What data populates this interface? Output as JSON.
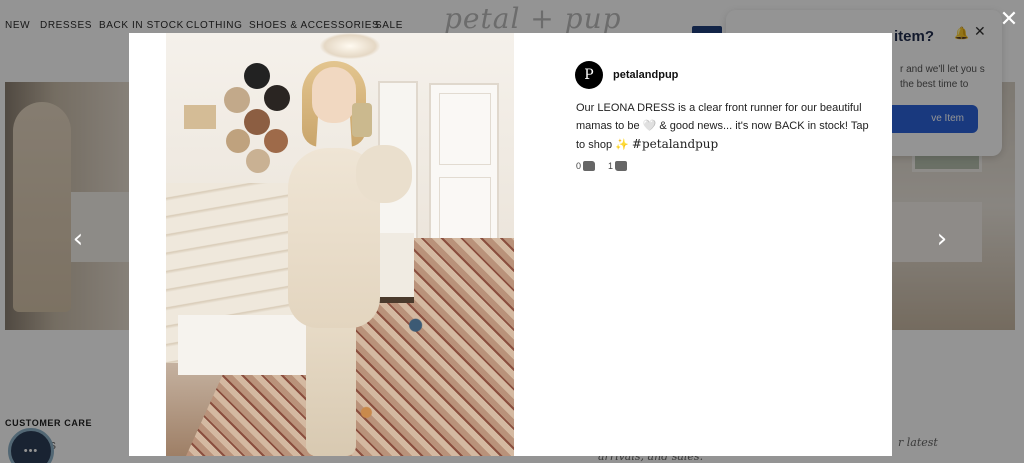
{
  "nav": {
    "items": [
      "NEW",
      "DRESSES",
      "BACK IN STOCK",
      "CLOTHING",
      "SHOES & ACCESSORIES",
      "SALE"
    ],
    "logo": "petal + pup"
  },
  "wishlist_popup": {
    "title": "item?",
    "text": "r and we'll let you s the best time to",
    "button": "ve Item"
  },
  "footer": {
    "heading": "CUSTOMER CARE",
    "sub": "US",
    "tag_left": "arrivals, and sales.",
    "tag_right": "r latest",
    "chat_dots": "•••"
  },
  "modal": {
    "avatar_letter": "P",
    "username": "petalandpup",
    "caption": "Our LEONA DRESS is a clear front runner for our beautiful mamas to be 🤍 & good news... it's now BACK in stock! Tap to shop ✨",
    "hashtag": "#petalandpup",
    "upvotes": "0",
    "downvotes": "1"
  },
  "controls": {
    "prev": "‹",
    "next": "›",
    "close": "✕"
  },
  "colors": {
    "overlay": "rgba(0,0,0,0.42)",
    "popup_button": "#2b62d9",
    "avatar_bg": "#000000"
  }
}
